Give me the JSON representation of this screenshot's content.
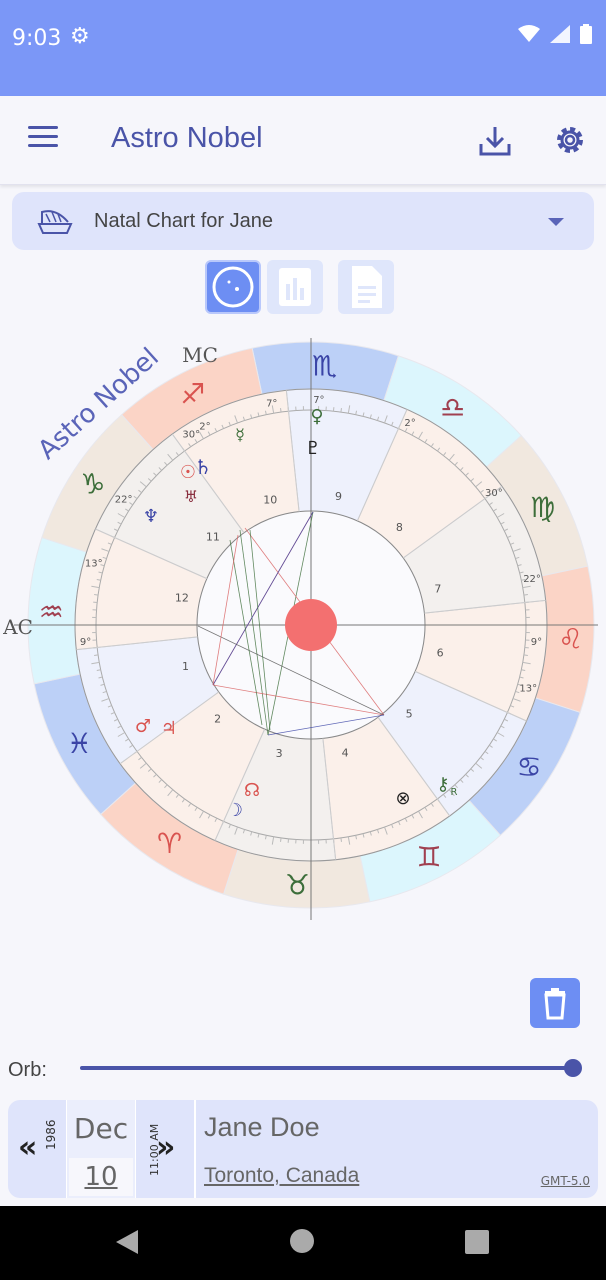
{
  "status_bar": {
    "time": "9:03"
  },
  "app_bar": {
    "title": "Astro Nobel"
  },
  "chart_selector": {
    "selected": "Natal Chart for Jane"
  },
  "wheel": {
    "watermark": "Astro Nobel",
    "angle_labels": {
      "mc": "MC",
      "ac": "AC"
    },
    "sign_glyphs": [
      "♏",
      "♎",
      "♍",
      "♌",
      "♋",
      "♊",
      "♉",
      "♈",
      "♓",
      "♒",
      "♑",
      "♐"
    ],
    "house_numbers": [
      "1",
      "2",
      "3",
      "4",
      "5",
      "6",
      "7",
      "8",
      "9",
      "10",
      "11",
      "12"
    ],
    "degree_labels": [
      "7°",
      "2°",
      "30°",
      "22°",
      "13°",
      "9°",
      "9°",
      "13°",
      "22°",
      "2°",
      "7°",
      "30°"
    ],
    "planet_glyphs": {
      "venus": "♀",
      "pluto": "♇",
      "mercury": "☿",
      "saturn": "♄",
      "sun": "☉",
      "uranus": "♅",
      "neptune": "♆",
      "mars": "♂",
      "jupiter": "♃",
      "node": "☊",
      "moon": "☽",
      "fortune": "⊗",
      "chiron": "⚷",
      "retro": "R"
    }
  },
  "orb": {
    "label": "Orb:",
    "value": 1.0
  },
  "info": {
    "year": "1986",
    "month": "Dec",
    "day": "10",
    "time": "11:00 AM",
    "name": "Jane Doe",
    "place": "Toronto, Canada",
    "timezone": "GMT-5.0",
    "prev": "«",
    "next": "»"
  }
}
